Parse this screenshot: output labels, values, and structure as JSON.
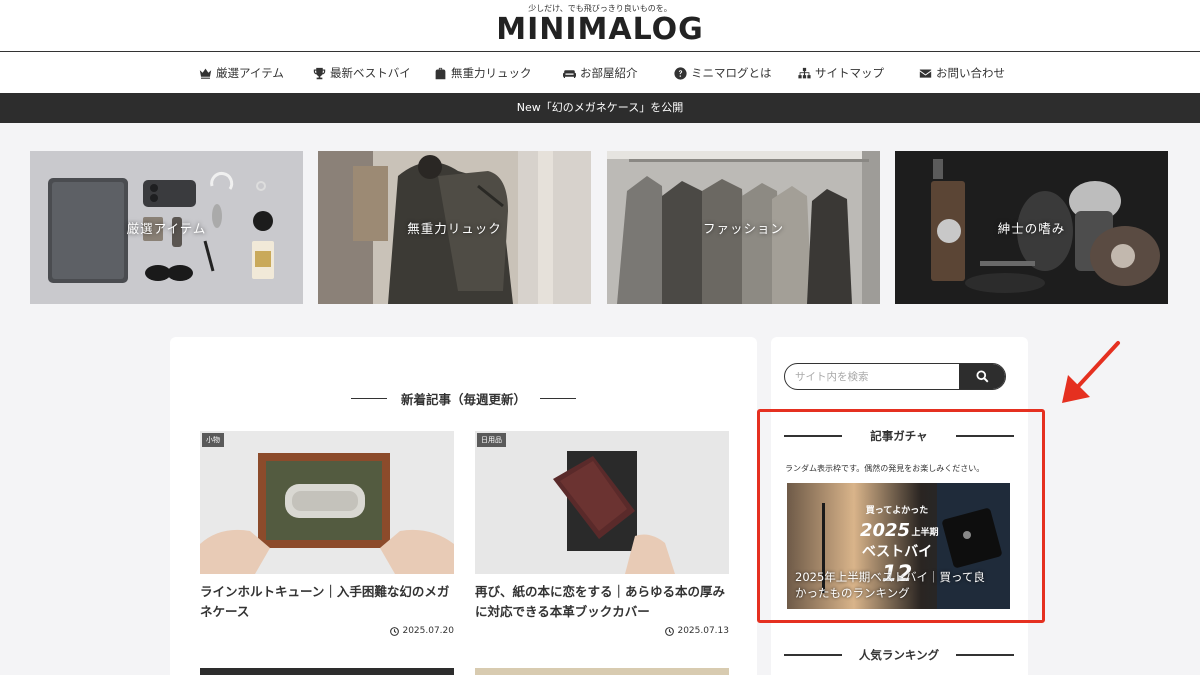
{
  "header": {
    "tagline": "少しだけ、でも飛びっきり良いものを。",
    "logo": "MINIMALOG"
  },
  "nav": {
    "items": [
      {
        "label": "厳選アイテム",
        "icon": "crown-icon"
      },
      {
        "label": "最新ベストバイ",
        "icon": "trophy-icon"
      },
      {
        "label": "無重力リュック",
        "icon": "backpack-icon"
      },
      {
        "label": "お部屋紹介",
        "icon": "couch-icon"
      },
      {
        "label": "ミニマログとは",
        "icon": "question-icon"
      },
      {
        "label": "サイトマップ",
        "icon": "sitemap-icon"
      },
      {
        "label": "お問い合わせ",
        "icon": "envelope-icon"
      }
    ]
  },
  "notice": "New「幻のメガネケース」を公開",
  "categories": [
    {
      "label": "厳選アイテム"
    },
    {
      "label": "無重力リュック"
    },
    {
      "label": "ファッション"
    },
    {
      "label": "紳士の嗜み"
    }
  ],
  "main": {
    "heading": "新着記事（毎週更新）",
    "posts": [
      {
        "tag": "小物",
        "title": "ラインホルトキューン｜入手困難な幻のメガネケース",
        "date": "2025.07.20"
      },
      {
        "tag": "日用品",
        "title": "再び、紙の本に恋をする｜あらゆる本の厚みに対応できる本革ブックカバー",
        "date": "2025.07.13"
      }
    ]
  },
  "sidebar": {
    "search_placeholder": "サイト内を検索",
    "gacha_title": "記事ガチャ",
    "gacha_desc": "ランダム表示枠です。偶然の発見をお楽しみください。",
    "gacha_image_text": {
      "line1": "買ってよかった",
      "line2": "2025",
      "line2b": "上半期",
      "line3": "ベストバイ",
      "line4": "12"
    },
    "gacha_caption": "2025年上半期ベストバイ｜買って良かったものランキング",
    "ranking_title": "人気ランキング"
  },
  "colors": {
    "accent": "#e53020",
    "dark": "#2d2d2d",
    "background": "#f4f4f6"
  }
}
